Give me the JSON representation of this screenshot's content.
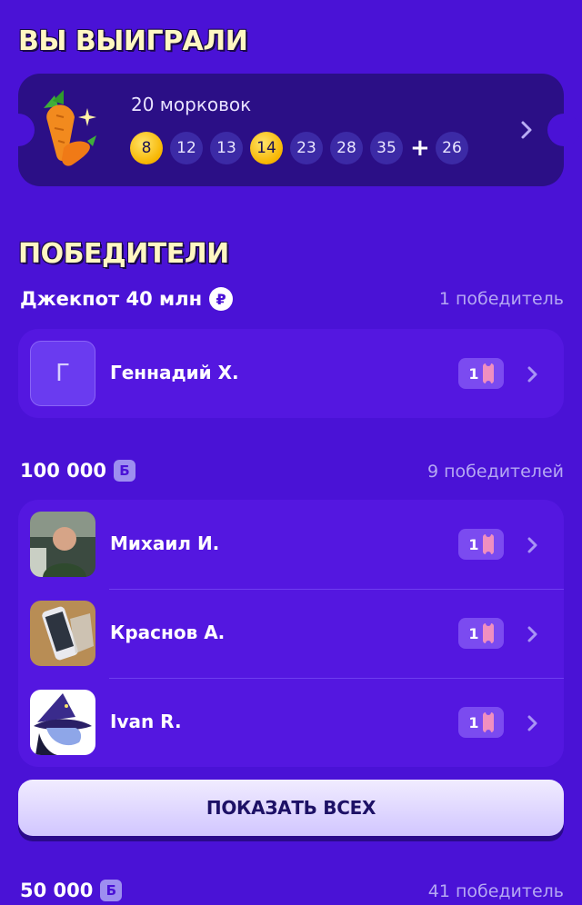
{
  "won_heading": "ВЫ ВЫИГРАЛИ",
  "ticket": {
    "prize": "20 морковок",
    "numbers": [
      "8",
      "12",
      "13",
      "14",
      "23",
      "28",
      "35"
    ],
    "hit_numbers": [
      "8",
      "14"
    ],
    "plus": "+",
    "bonus": "26"
  },
  "winners_heading": "ПОБЕДИТЕЛИ",
  "jackpot": {
    "label": "Джекпот 40 млн",
    "currency_icon": "₽",
    "count": "1 победитель",
    "winners": [
      {
        "avatar_letter": "Г",
        "name": "Геннадий Х.",
        "tickets": "1"
      }
    ]
  },
  "tier_100k": {
    "amount": "100 000",
    "currency_icon": "Б",
    "count": "9 победителей",
    "winners": [
      {
        "name": "Михаил И.",
        "tickets": "1"
      },
      {
        "name": "Краснов А.",
        "tickets": "1"
      },
      {
        "name": "Ivan R.",
        "tickets": "1"
      }
    ]
  },
  "show_all_label": "ПОКАЗАТЬ ВСЕХ",
  "tier_50k": {
    "amount": "50 000",
    "currency_icon": "Б",
    "count": "41 победитель"
  },
  "colors": {
    "background": "#4a12d6",
    "ticket_card": "#2b0f86",
    "card": "#5417e0",
    "hit_ball": "#f7b500",
    "heading": "#fff7c2"
  }
}
